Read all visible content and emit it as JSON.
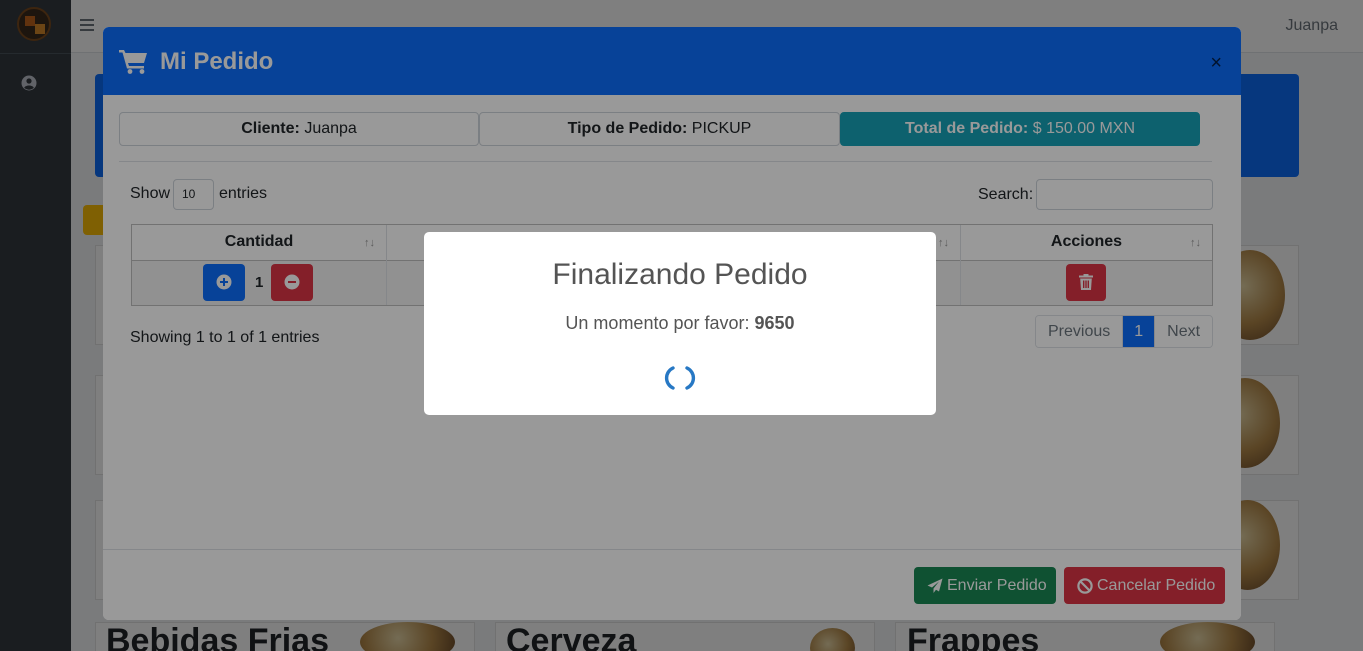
{
  "topbar": {
    "user_name": "Juanpa"
  },
  "background_categories": [
    "Bebidas Frias",
    "Cerveza",
    "Frappes"
  ],
  "modal": {
    "title": "Mi Pedido",
    "close_symbol": "×",
    "info": {
      "cliente_label": "Cliente:",
      "cliente_value": "Juanpa",
      "tipo_label": "Tipo de Pedido:",
      "tipo_value": "PICKUP",
      "total_label": "Total de Pedido:",
      "total_value": "$ 150.00 MXN"
    },
    "table": {
      "show_label": "Show",
      "entries_select": "10",
      "entries_label": "entries",
      "search_label": "Search:",
      "search_value": "",
      "columns": [
        "Cantidad",
        "Acciones"
      ],
      "rows": [
        {
          "cantidad": "1"
        }
      ],
      "info_text": "Showing 1 to 1 of 1 entries",
      "pagination": {
        "previous": "Previous",
        "current": "1",
        "next": "Next"
      }
    },
    "footer": {
      "send_label": "Enviar Pedido",
      "cancel_label": "Cancelar Pedido"
    }
  },
  "popup": {
    "title": "Finalizando Pedido",
    "text": "Un momento por favor:",
    "code": "9650"
  },
  "colors": {
    "primary": "#0d6efd",
    "info": "#17a2b8",
    "success": "#198754",
    "danger": "#dc3545",
    "sidebar": "#343a40",
    "spinner": "#2778c4"
  },
  "icons": [
    "logo",
    "hamburger-icon",
    "user-circle-icon",
    "cart-icon",
    "close-icon",
    "plus-circle-icon",
    "minus-circle-icon",
    "trash-icon",
    "paper-plane-icon",
    "ban-icon",
    "sort-icon",
    "loading-spinner"
  ]
}
